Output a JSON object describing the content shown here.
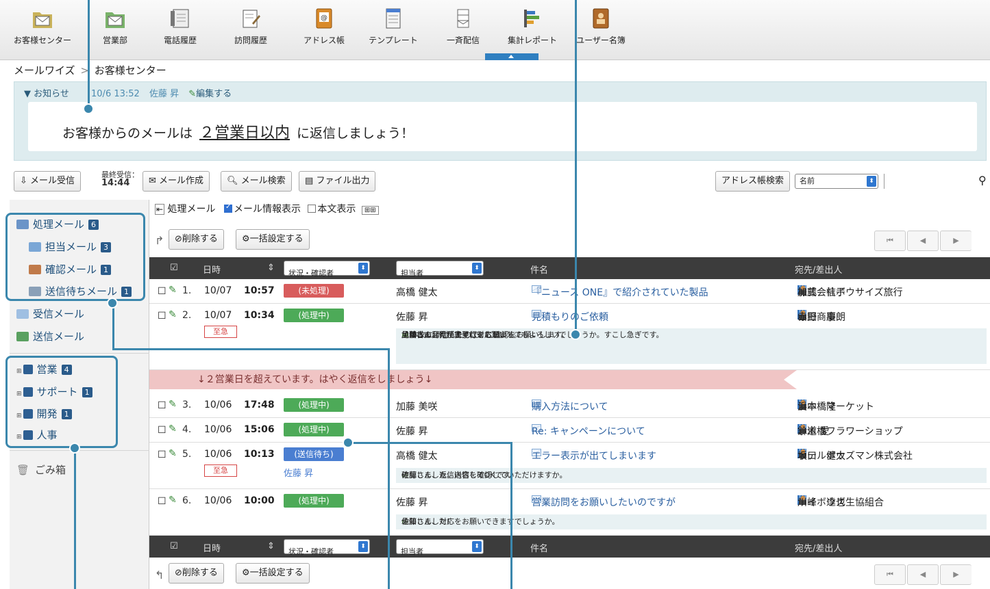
{
  "apps": [
    {
      "label": "お客様センター",
      "icon": "folder-mail-icon"
    },
    {
      "label": "営業部",
      "icon": "folder-mail-green-icon"
    },
    {
      "label": "電話履歴",
      "icon": "phone-log-icon"
    },
    {
      "label": "訪問履歴",
      "icon": "visit-log-icon"
    },
    {
      "label": "アドレス帳",
      "icon": "address-book-icon"
    },
    {
      "label": "テンプレート",
      "icon": "template-icon"
    },
    {
      "label": "一斉配信",
      "icon": "broadcast-icon"
    },
    {
      "label": "集計レポート",
      "icon": "report-icon"
    },
    {
      "label": "ユーザー名簿",
      "icon": "user-directory-icon"
    }
  ],
  "breadcrumb": {
    "root": "メールワイズ",
    "sep": ">",
    "current": "お客様センター"
  },
  "notice": {
    "toggle": "▼ お知らせ",
    "date": "10/6 13:52",
    "author": "佐藤 昇",
    "edit": "編集する",
    "text_before": "お客様からのメールは",
    "highlight": "２営業日以内",
    "text_after": "に返信しましょう！"
  },
  "toolbar": {
    "receive": "メール受信",
    "last_label": "最終受信：",
    "last_time": "14:44",
    "compose": "メール作成",
    "search": "メール検索",
    "export": "ファイル出力",
    "address_search": "アドレス帳検索",
    "address_field": "名前"
  },
  "sidebar": {
    "processing": {
      "label": "処理メール",
      "count": "6"
    },
    "assigned": {
      "label": "担当メール",
      "count": "3"
    },
    "confirm": {
      "label": "確認メール",
      "count": "1"
    },
    "pending": {
      "label": "送信待ちメール",
      "count": "1"
    },
    "received": {
      "label": "受信メール"
    },
    "sent": {
      "label": "送信メール"
    },
    "folders": [
      {
        "label": "営業",
        "count": "4"
      },
      {
        "label": "サポート",
        "count": "1"
      },
      {
        "label": "開発",
        "count": "1"
      },
      {
        "label": "人事",
        "count": ""
      }
    ],
    "trash": {
      "label": "ごみ箱"
    }
  },
  "list": {
    "title": "処理メール",
    "show_info": "メール情報表示",
    "show_body": "本文表示",
    "delete": "削除する",
    "bulk": "一括設定する",
    "headers": {
      "date": "日時",
      "status": "状況・確認者",
      "assignee": "担当者",
      "subject": "件名",
      "party": "宛先/差出人"
    },
    "alert": "↓２営業日を超えています。はやく返信をしましょう↓",
    "rows": [
      {
        "no": "1.",
        "date": "10/07",
        "time": "10:57",
        "status": "(未処理)",
        "status_color": "#d85c5c",
        "assignee": "高橋 健太",
        "subject": "『ニュース ONE』で紹介されていた製品",
        "company": "株式会社ボウサイズ旅行",
        "person": "加藤　信子"
      },
      {
        "no": "2.",
        "date": "10/07",
        "time": "10:34",
        "status": "(処理中)",
        "status_color": "#4daa58",
        "assignee": "佐藤 昇",
        "subject": "見積もりのご依頼",
        "company": "山田商事",
        "person": "赤野　慶朗",
        "urgent": "至急",
        "memo1": "見積書の発行が完了しました。",
        "memo2": "本文に添付したので、ご確認をお願いします。",
        "memo3": "承知しました！すぐに対応します。",
        "memo4": "加藤さん、見積書発行をお願いしてもよろしいでしょうか。すこし急ぎです。"
      },
      {
        "no": "3.",
        "date": "10/06",
        "time": "17:48",
        "status": "(処理中)",
        "status_color": "#4daa58",
        "assignee": "加藤 美咲",
        "subject": "購入方法について",
        "company": "日本橋マーケット",
        "person": "浜中　隆"
      },
      {
        "no": "4.",
        "date": "10/06",
        "time": "15:06",
        "status": "(処理中)",
        "status_color": "#4daa58",
        "assignee": "佐藤 昇",
        "subject": "Re: キャンペーンについて",
        "company": "水道橋フラワーショップ",
        "person": "鈴木 愛"
      },
      {
        "no": "5.",
        "date": "10/06",
        "time": "10:13",
        "status": "(送信待ち)",
        "status_color": "#4a7ed1",
        "assignee": "高橋 健太",
        "subject": "エラー表示が出てしまいます",
        "company": "ホテルボウズマン株式会社",
        "person": "坂口　健太",
        "urgent": "至急",
        "confirmer": "佐藤 昇",
        "memo1": "確認しました。送信してOKです。",
        "memo2": "佐藤さん、返信内容を確認していただけますか。"
      },
      {
        "no": "6.",
        "date": "10/06",
        "time": "10:00",
        "status": "(処理中)",
        "status_color": "#4daa58",
        "assignee": "佐藤 昇",
        "subject": "営業訪問をお願いしたいのですが",
        "company": "サイボウズ生協組合",
        "person": "川峰　達也",
        "memo1": "承知しました！",
        "memo2": "佐藤さん、対応をお願いできますでしょうか。"
      }
    ]
  },
  "colors": {
    "accent": "#3b87ad",
    "header": "#3c3c3c",
    "notice_bg": "#deecef"
  }
}
